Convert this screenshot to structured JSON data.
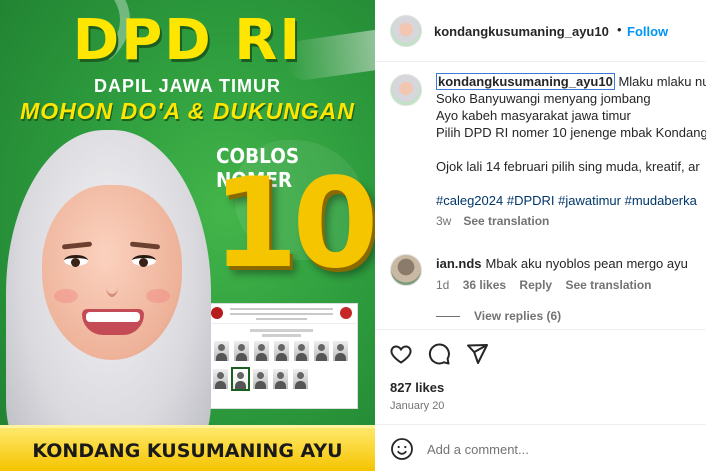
{
  "poster": {
    "title": "DPD RI",
    "subtitle1": "DAPIL JAWA TIMUR",
    "subtitle2": "MOHON DO'A & DUKUNGAN",
    "coblos": "COBLOS NOMER",
    "number": "10",
    "name": "KONDANG KUSUMANING AYU",
    "ballot_selected_index": 9,
    "colors": {
      "background": "#2e9d3e",
      "accent_yellow": "#ffe600",
      "number_gold": "#f5c500"
    }
  },
  "header": {
    "username": "kondangkusumaning_ayu10",
    "separator": "•",
    "follow_label": "Follow"
  },
  "caption": {
    "username": "kondangkusumaning_ayu10",
    "first_line_rest": "Mlaku mlaku nu",
    "lines": [
      "Soko Banyuwangi menyang jombang",
      "Ayo kabeh masyarakat jawa timur",
      "Pilih DPD RI nomer 10 jenenge mbak Kondang"
    ],
    "line_after_gap": "Ojok lali 14 februari pilih sing muda, kreatif, ar",
    "hashtags": "#caleg2024 #DPDRI #jawatimur #mudaberka",
    "time": "3w",
    "see_translation": "See translation"
  },
  "comment": {
    "username": "ian.nds",
    "text": "Mbak aku nyoblos pean mergo ayu",
    "time": "1d",
    "likes": "36 likes",
    "reply": "Reply",
    "see_translation": "See translation"
  },
  "view_replies": "View replies (6)",
  "actions": {
    "icons": [
      "heart-icon",
      "comment-icon",
      "share-icon"
    ]
  },
  "likes": "827 likes",
  "date": "January 20",
  "add_comment": {
    "placeholder": "Add a comment..."
  }
}
